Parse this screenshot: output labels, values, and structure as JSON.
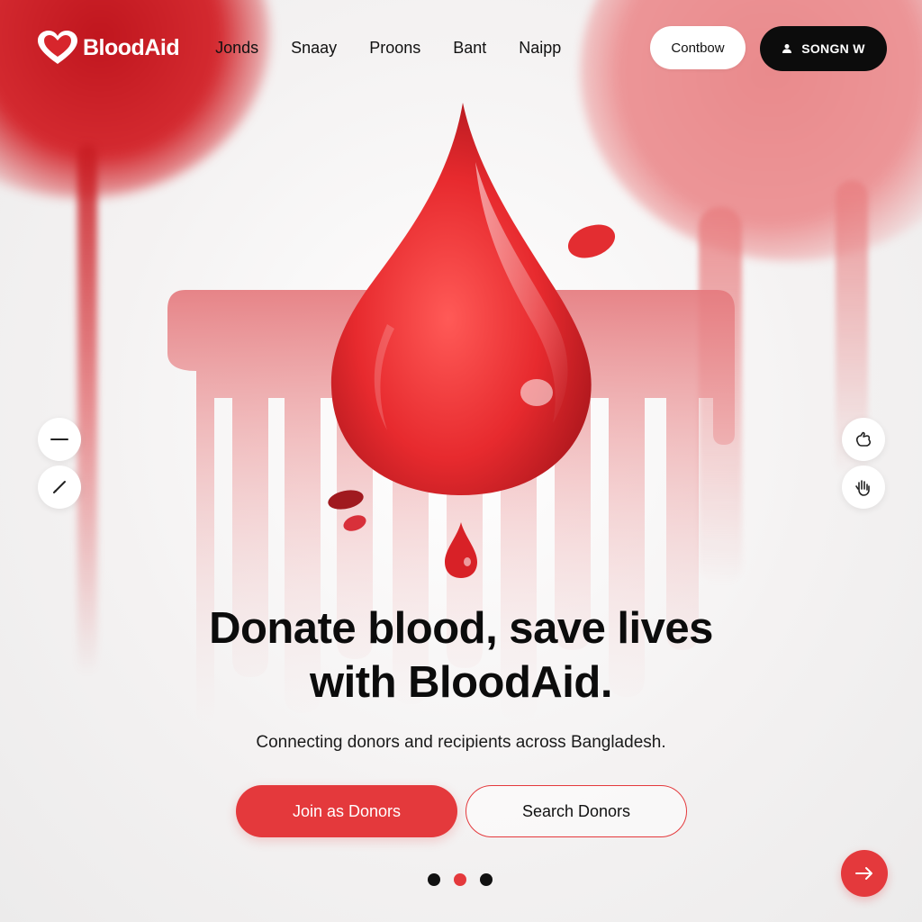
{
  "brand": {
    "name": "BloodAid",
    "logo_icon": "heart-icon"
  },
  "nav": {
    "links": [
      "Jonds",
      "Snaay",
      "Proons",
      "Bant",
      "Naipp"
    ],
    "contact_label": "Contbow",
    "signin_label": "SONGN W",
    "signin_icon": "user-icon"
  },
  "side_controls": {
    "left": [
      "minus-icon",
      "pen-icon"
    ],
    "right": [
      "hand-icon",
      "hand-wave-icon"
    ]
  },
  "hero": {
    "illustration": "blood-drop-icon",
    "headline_line1": "Donate blood, save lives",
    "headline_line2": "with BloodAid.",
    "subheadline": "Connecting donors and recipients across Bangladesh.",
    "primary_cta": "Join as Donors",
    "secondary_cta": "Search Donors"
  },
  "carousel": {
    "slide_count": 3,
    "active_slide": 2,
    "next_icon": "arrow-right-icon"
  },
  "colors": {
    "accent": "#e4393c",
    "dark": "#0c0c0c",
    "text": "#111111"
  }
}
